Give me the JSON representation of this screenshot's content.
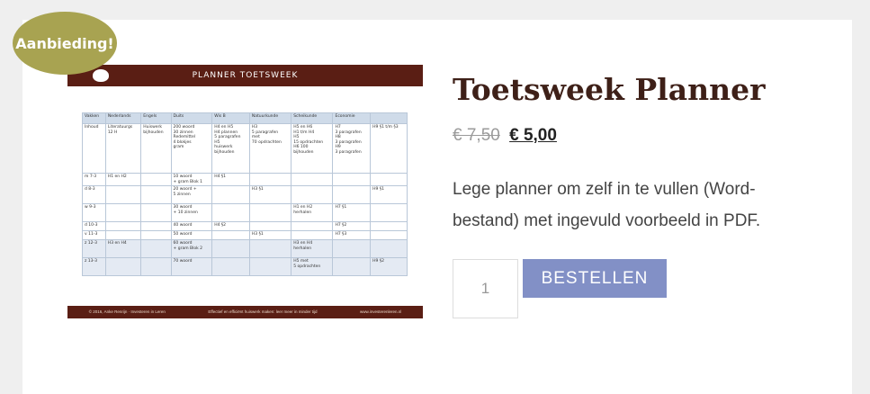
{
  "badge": {
    "label": "Aanbieding!"
  },
  "product_image": {
    "header_title": "PLANNER TOETSWEEK",
    "table": {
      "headers": [
        "Vakken",
        "Nederlands",
        "Engels",
        "Duits",
        "Wis B",
        "Natuurkunde",
        "Scheikunde",
        "Economie",
        ""
      ],
      "rows": [
        [
          "Inhoud",
          "Literatuurgs\n12 H",
          "Huiswerk\nbijhouden",
          "200 woord\n30 zinnen\nRedemittel\n4 blokjes\ngram",
          "H4 en H5\nH4 plannen\n5 paragrafen\nH5\nhuiswerk\nbijhouden",
          "H3\n5 paragrafen\nmet\n70 opdrachten",
          "H5 en H6\nH1 t/m H4\nH5\n15 opdrachten\nH6 100\nbijhouden",
          "H7\n3 paragrafen\nH8\n3 paragrafen\nH9\n3 paragrafen",
          "H9 §1 t/m §3"
        ],
        [
          "m 7-3",
          "H1 en H2",
          "",
          "10 woord\n+ gram Blok 1",
          "H4 §1",
          "",
          "",
          "",
          ""
        ],
        [
          "d 8-3",
          "",
          "",
          "20 woord +\n5 zinnen",
          "",
          "H3 §1",
          "",
          "",
          "H9 §1"
        ],
        [
          "w 9-3",
          "",
          "",
          "30 woord\n+ 10 zinnen",
          "",
          "",
          "H1 en H2\nherhalen",
          "H7 §1",
          ""
        ],
        [
          "d 10-3",
          "",
          "",
          "40 woord",
          "H4 §2",
          "",
          "",
          "H7 §2",
          ""
        ],
        [
          "v 11-3",
          "",
          "",
          "50 woord",
          "",
          "H3 §1",
          "",
          "H7 §3",
          ""
        ],
        [
          "z 12-3",
          "H3 en H4",
          "",
          "60 woord\n+ gram Blok 2",
          "",
          "",
          "H3 en H4\nherhalen",
          "",
          ""
        ],
        [
          "z 13-3",
          "",
          "",
          "70 woord",
          "",
          "",
          "H5 met\n5 opdrachten",
          "",
          "H9 §2"
        ]
      ]
    },
    "footer": {
      "copyright": "© 2016, Anke Renrijn · Investeren in Leren",
      "tagline": "Effectief en efficiënt huiswerk maken: leer meer in minder tijd",
      "website": "www.investerenleren.nl"
    }
  },
  "product": {
    "title": "Toetsweek Planner",
    "old_price": "€ 7,50",
    "new_price": "€ 5,00",
    "description": "Lege planner om zelf in te vullen (Word-bestand) met ingevuld voorbeeld in PDF.",
    "quantity": "1",
    "order_label": "BESTELLEN"
  },
  "colors": {
    "badge": "#a8a351",
    "button": "#8290c6",
    "title": "#3e2018",
    "image_header": "#5a1e14"
  }
}
